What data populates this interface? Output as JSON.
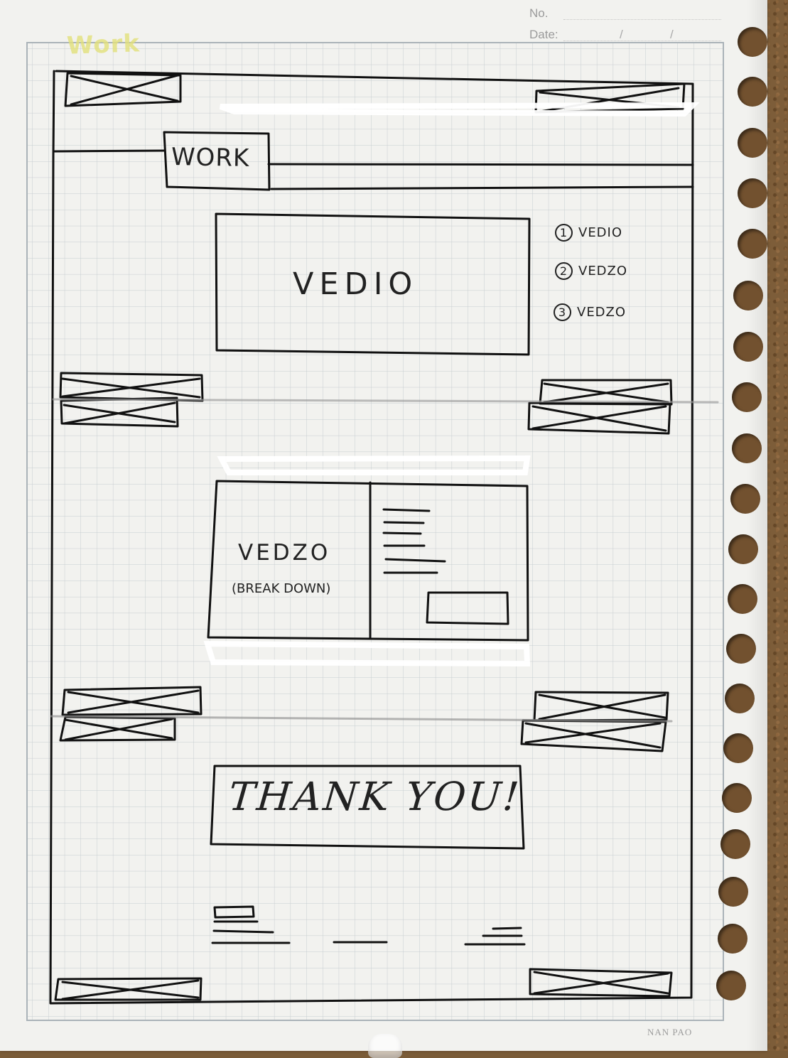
{
  "paper": {
    "no_label": "No.",
    "date_label": "Date:",
    "date_separator_1": "/",
    "date_separator_2": "/",
    "highlight_title": "Work",
    "brand": "NAN PAO"
  },
  "wireframe": {
    "work_label": "WORK",
    "main_video_label": "VEDIO",
    "menu": [
      {
        "number": "1",
        "label": "VEDIO"
      },
      {
        "number": "2",
        "label": "VEDZO"
      },
      {
        "number": "3",
        "label": "VEDZO"
      }
    ],
    "breakdown_title": "VEDZO",
    "breakdown_subtitle": "(BREAK DOWN)",
    "thanks": "THANK YOU!"
  },
  "icons": {
    "image_placeholder": "crossed-box-icon",
    "circled_number": "circle-number-icon"
  }
}
